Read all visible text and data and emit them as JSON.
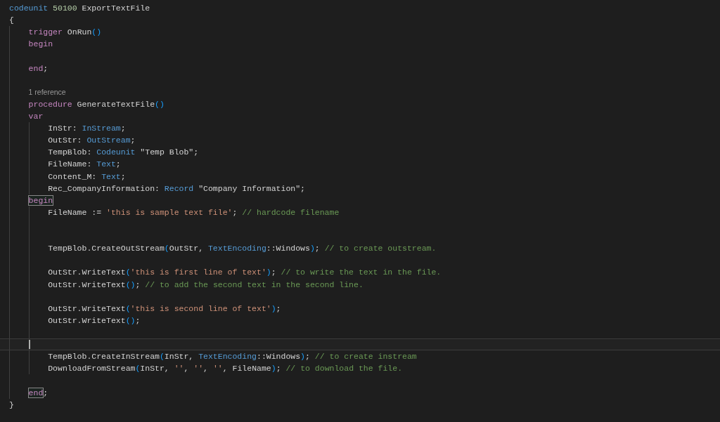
{
  "editor": {
    "lines": [
      {
        "current": false,
        "tokens": [
          {
            "text": "codeunit",
            "kind": "type"
          },
          {
            "text": " 50100",
            "kind": "num"
          },
          {
            "text": " ExportTextFile",
            "kind": "plain"
          }
        ]
      },
      {
        "current": false,
        "tokens": [
          {
            "text": "{",
            "kind": "plain"
          }
        ]
      },
      {
        "current": false,
        "tokens": [
          {
            "text": "    trigger",
            "kind": "kw"
          },
          {
            "text": " OnRun",
            "kind": "plain"
          },
          {
            "text": "()",
            "kind": "paren"
          }
        ]
      },
      {
        "current": false,
        "tokens": [
          {
            "text": "    begin",
            "kind": "kw"
          }
        ]
      },
      {
        "current": false
      },
      {
        "current": false,
        "tokens": [
          {
            "text": "    end",
            "kind": "kw"
          },
          {
            "text": ";",
            "kind": "plain"
          }
        ]
      },
      {
        "current": false
      },
      {
        "current": false,
        "codelens": "1 reference"
      },
      {
        "current": false,
        "tokens": [
          {
            "text": "    procedure",
            "kind": "kw"
          },
          {
            "text": " GenerateTextFile",
            "kind": "plain"
          },
          {
            "text": "()",
            "kind": "paren"
          }
        ]
      },
      {
        "current": false,
        "tokens": [
          {
            "text": "    var",
            "kind": "kw"
          }
        ]
      },
      {
        "current": false,
        "tokens": [
          {
            "text": "        InStr: ",
            "kind": "plain"
          },
          {
            "text": "InStream",
            "kind": "type"
          },
          {
            "text": ";",
            "kind": "plain"
          }
        ]
      },
      {
        "current": false,
        "tokens": [
          {
            "text": "        OutStr: ",
            "kind": "plain"
          },
          {
            "text": "OutStream",
            "kind": "type"
          },
          {
            "text": ";",
            "kind": "plain"
          }
        ]
      },
      {
        "current": false,
        "tokens": [
          {
            "text": "        TempBlob: ",
            "kind": "plain"
          },
          {
            "text": "Codeunit",
            "kind": "type"
          },
          {
            "text": " \"Temp Blob\";",
            "kind": "plain"
          }
        ]
      },
      {
        "current": false,
        "tokens": [
          {
            "text": "        FileName: ",
            "kind": "plain"
          },
          {
            "text": "Text",
            "kind": "type"
          },
          {
            "text": ";",
            "kind": "plain"
          }
        ]
      },
      {
        "current": false,
        "tokens": [
          {
            "text": "        Content_M: ",
            "kind": "plain"
          },
          {
            "text": "Text",
            "kind": "type"
          },
          {
            "text": ";",
            "kind": "plain"
          }
        ]
      },
      {
        "current": false,
        "tokens": [
          {
            "text": "        Rec_CompanyInformation: ",
            "kind": "plain"
          },
          {
            "text": "Record",
            "kind": "type"
          },
          {
            "text": " \"Company Information\";",
            "kind": "plain"
          }
        ]
      },
      {
        "current": false,
        "tokens": [
          {
            "text": "    begin",
            "kind": "kw",
            "matched": true
          }
        ]
      },
      {
        "current": false,
        "tokens": [
          {
            "text": "        FileName := ",
            "kind": "plain"
          },
          {
            "text": "'this is sample text file'",
            "kind": "str"
          },
          {
            "text": ";",
            "kind": "plain"
          },
          {
            "text": " // hardcode filename",
            "kind": "com"
          }
        ]
      },
      {
        "current": false
      },
      {
        "current": false
      },
      {
        "current": false,
        "tokens": [
          {
            "text": "        TempBlob.CreateOutStream",
            "kind": "plain"
          },
          {
            "text": "(",
            "kind": "paren"
          },
          {
            "text": "OutStr, ",
            "kind": "plain"
          },
          {
            "text": "TextEncoding",
            "kind": "type"
          },
          {
            "text": "::Windows",
            "kind": "plain"
          },
          {
            "text": ")",
            "kind": "paren"
          },
          {
            "text": ";",
            "kind": "plain"
          },
          {
            "text": " // to create outstream.",
            "kind": "com"
          }
        ]
      },
      {
        "current": false
      },
      {
        "current": false,
        "tokens": [
          {
            "text": "        OutStr.WriteText",
            "kind": "plain"
          },
          {
            "text": "(",
            "kind": "paren"
          },
          {
            "text": "'this is first line of text'",
            "kind": "str"
          },
          {
            "text": ")",
            "kind": "paren"
          },
          {
            "text": ";",
            "kind": "plain"
          },
          {
            "text": " // to write the text in the file.",
            "kind": "com"
          }
        ]
      },
      {
        "current": false,
        "tokens": [
          {
            "text": "        OutStr.WriteText",
            "kind": "plain"
          },
          {
            "text": "()",
            "kind": "paren"
          },
          {
            "text": ";",
            "kind": "plain"
          },
          {
            "text": " // to add the second text in the second line.",
            "kind": "com"
          }
        ]
      },
      {
        "current": false
      },
      {
        "current": false,
        "tokens": [
          {
            "text": "        OutStr.WriteText",
            "kind": "plain"
          },
          {
            "text": "(",
            "kind": "paren"
          },
          {
            "text": "'this is second line of text'",
            "kind": "str"
          },
          {
            "text": ")",
            "kind": "paren"
          },
          {
            "text": ";",
            "kind": "plain"
          }
        ]
      },
      {
        "current": false,
        "tokens": [
          {
            "text": "        OutStr.WriteText",
            "kind": "plain"
          },
          {
            "text": "()",
            "kind": "paren"
          },
          {
            "text": ";",
            "kind": "plain"
          }
        ]
      },
      {
        "current": false
      },
      {
        "current": true
      },
      {
        "current": false,
        "tokens": [
          {
            "text": "        TempBlob.CreateInStream",
            "kind": "plain"
          },
          {
            "text": "(",
            "kind": "paren"
          },
          {
            "text": "InStr, ",
            "kind": "plain"
          },
          {
            "text": "TextEncoding",
            "kind": "type"
          },
          {
            "text": "::Windows",
            "kind": "plain"
          },
          {
            "text": ")",
            "kind": "paren"
          },
          {
            "text": ";",
            "kind": "plain"
          },
          {
            "text": " // to create instream",
            "kind": "com"
          }
        ]
      },
      {
        "current": false,
        "tokens": [
          {
            "text": "        DownloadFromStream",
            "kind": "plain"
          },
          {
            "text": "(",
            "kind": "paren"
          },
          {
            "text": "InStr, ",
            "kind": "plain"
          },
          {
            "text": "''",
            "kind": "str"
          },
          {
            "text": ", ",
            "kind": "plain"
          },
          {
            "text": "''",
            "kind": "str"
          },
          {
            "text": ", ",
            "kind": "plain"
          },
          {
            "text": "''",
            "kind": "str"
          },
          {
            "text": ", FileName",
            "kind": "plain"
          },
          {
            "text": ")",
            "kind": "paren"
          },
          {
            "text": ";",
            "kind": "plain"
          },
          {
            "text": " // to download the file.",
            "kind": "com"
          }
        ]
      },
      {
        "current": false
      },
      {
        "current": false,
        "tokens": [
          {
            "text": "    end",
            "kind": "kw",
            "matched": true
          },
          {
            "text": ";",
            "kind": "plain"
          }
        ]
      },
      {
        "current": false,
        "tokens": [
          {
            "text": "}",
            "kind": "plain"
          }
        ]
      }
    ]
  }
}
